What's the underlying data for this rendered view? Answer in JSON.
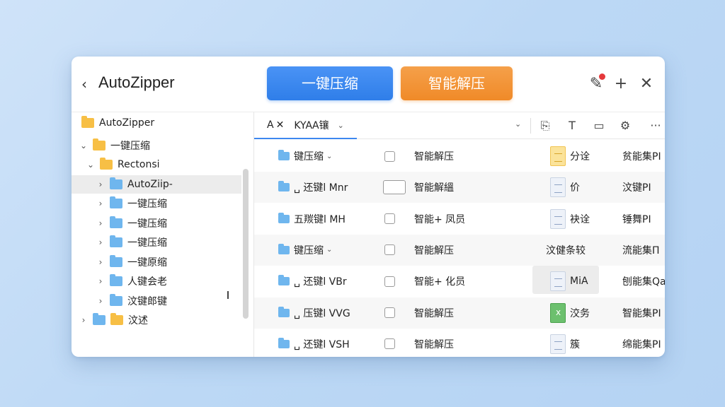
{
  "app": {
    "title": "AutoZipper"
  },
  "actions": {
    "compress": "一键压缩",
    "extract": "智能解压"
  },
  "icons": {
    "back": "chevron-left-icon",
    "edit": "edit-icon",
    "add": "plus-icon",
    "close": "close-icon"
  },
  "colors": {
    "compress": "#2f7ee9",
    "extract": "#f08a28",
    "badge": "#e5383b"
  },
  "sidebar": {
    "items": [
      {
        "label": "AutoZipper",
        "level": 0,
        "color": "yellow",
        "chevron": ""
      },
      {
        "label": "一键压缩",
        "level": 0,
        "color": "yellow",
        "chevron": "⌄"
      },
      {
        "label": "Rectonsi",
        "level": 1,
        "color": "yellow",
        "chevron": "⌄"
      },
      {
        "label": "AutoZiip-",
        "level": 2,
        "color": "blue",
        "chevron": "›",
        "selected": true
      },
      {
        "label": "一键压缩",
        "level": 2,
        "color": "blue",
        "chevron": "›"
      },
      {
        "label": "一键压缩",
        "level": 2,
        "color": "blue",
        "chevron": "›"
      },
      {
        "label": "一键压缩",
        "level": 2,
        "color": "blue",
        "chevron": "›"
      },
      {
        "label": "一键原缩",
        "level": 2,
        "color": "blue",
        "chevron": "›"
      },
      {
        "label": "人键会老",
        "level": 2,
        "color": "blue",
        "chevron": "›"
      },
      {
        "label": "汶键郎键",
        "level": 2,
        "color": "blue",
        "chevron": "›"
      },
      {
        "label": "汶述",
        "level": 0,
        "color": "blue",
        "chevron": "›",
        "extra_folder": "yellow"
      }
    ]
  },
  "toolbar": {
    "tab": {
      "a": "A",
      "x": "✕",
      "label": "KYAΑ镶",
      "dd": "⌄"
    },
    "dd2": "⌄",
    "tools": [
      "⎘",
      "T",
      "▭",
      "⚙",
      "···"
    ]
  },
  "rows": [
    {
      "name": "键压缩",
      "dd": "⌄",
      "check": "box",
      "type": "智能解压",
      "doc": "yellow",
      "kind": "分诠",
      "extra": "贫能集PI"
    },
    {
      "name": "␣ 还键l Mnr",
      "check": "folder",
      "type": "智能解縕",
      "doc": "plain",
      "kind": "价",
      "extra": "汶键PI"
    },
    {
      "name": "五羰键l MH",
      "check": "box",
      "type": "智能+ 凤员",
      "doc": "plain",
      "kind": "袂诠",
      "extra": "锤舞PI"
    },
    {
      "name": "键压缩",
      "dd": "⌄",
      "check": "box",
      "type": "智能解压",
      "doc": "none",
      "kind": "汶健条较",
      "extra": "流能集Π"
    },
    {
      "name": "␣ 还键l VBr",
      "check": "box",
      "type": "智能+ 化员",
      "doc": "plain",
      "kind": "MiA",
      "extra": "刨能集Qa",
      "hilite": true
    },
    {
      "name": "␣ 压键l VVG",
      "check": "box",
      "type": "智能解压",
      "doc": "green",
      "kind": "洨务",
      "extra": "智能集PI"
    },
    {
      "name": "␣ 还键l VSH",
      "check": "box",
      "type": "智能解压",
      "doc": "plain",
      "kind": "簇",
      "extra": "绵能集PI"
    }
  ]
}
